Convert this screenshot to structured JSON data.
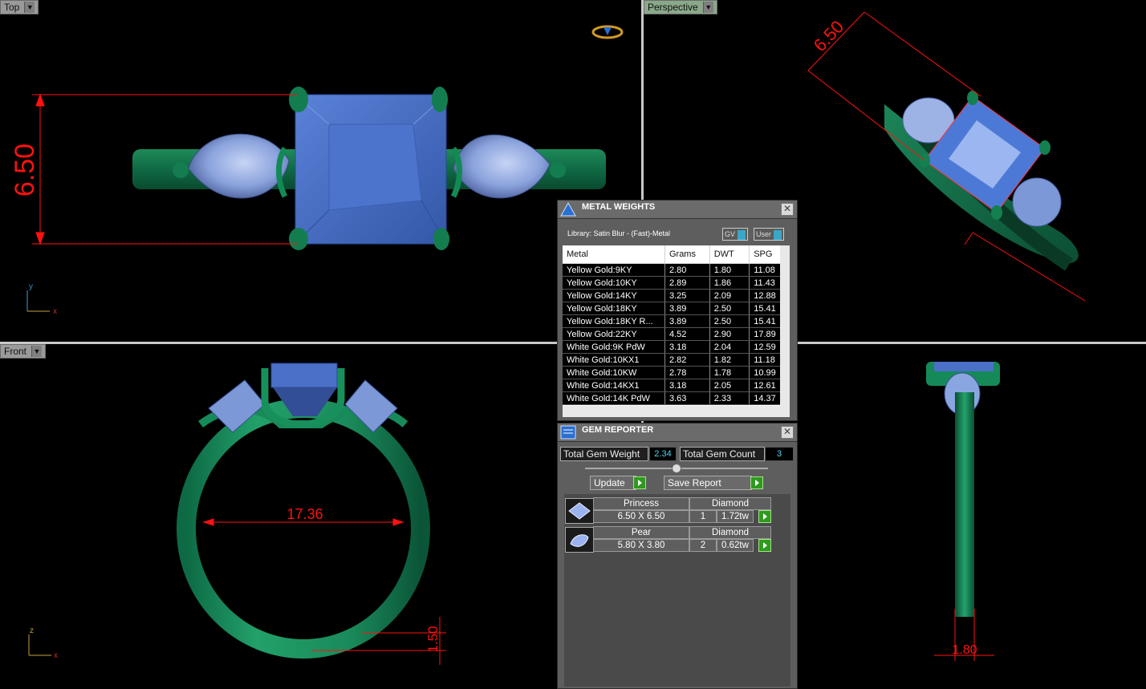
{
  "viewports": {
    "top": {
      "label": "Top",
      "dimension": "6.50",
      "axis_x": "x",
      "axis_y": "y"
    },
    "perspective": {
      "label": "Perspective",
      "dimension": "6.50"
    },
    "front": {
      "label": "Front",
      "dimension_width": "17.36",
      "dimension_thickness": "1.50",
      "axis_x": "x",
      "axis_z": "z"
    },
    "right": {
      "dimension": "1.80"
    }
  },
  "metal_weights": {
    "title": "METAL WEIGHTS",
    "library": "Library: Satin Blur - (Fast)-Metal",
    "toggle_gv": "GV",
    "toggle_user": "User",
    "columns": [
      "Metal",
      "Grams",
      "DWT",
      "SPG"
    ],
    "rows": [
      [
        "Yellow Gold:9KY",
        "2.80",
        "1.80",
        "11.08"
      ],
      [
        "Yellow Gold:10KY",
        "2.89",
        "1.86",
        "11.43"
      ],
      [
        "Yellow Gold:14KY",
        "3.25",
        "2.09",
        "12.88"
      ],
      [
        "Yellow Gold:18KY",
        "3.89",
        "2.50",
        "15.41"
      ],
      [
        "Yellow Gold:18KY R...",
        "3.89",
        "2.50",
        "15.41"
      ],
      [
        "Yellow Gold:22KY",
        "4.52",
        "2.90",
        "17.89"
      ],
      [
        "White Gold:9K PdW",
        "3.18",
        "2.04",
        "12.59"
      ],
      [
        "White Gold:10KX1",
        "2.82",
        "1.82",
        "11.18"
      ],
      [
        "White Gold:10KW",
        "2.78",
        "1.78",
        "10.99"
      ],
      [
        "White Gold:14KX1",
        "3.18",
        "2.05",
        "12.61"
      ],
      [
        "White Gold:14K PdW",
        "3.63",
        "2.33",
        "14.37"
      ]
    ]
  },
  "gem_reporter": {
    "title": "GEM REPORTER",
    "total_weight_label": "Total Gem Weight",
    "total_weight_value": "2.34",
    "total_count_label": "Total Gem Count",
    "total_count_value": "3",
    "update_label": "Update",
    "save_label": "Save Report",
    "gems": [
      {
        "shape": "Princess",
        "type": "Diamond",
        "size": "6.50 X 6.50",
        "count": "1",
        "weight": "1.72tw"
      },
      {
        "shape": "Pear",
        "type": "Diamond",
        "size": "5.80 X 3.80",
        "count": "2",
        "weight": "0.62tw"
      }
    ]
  }
}
